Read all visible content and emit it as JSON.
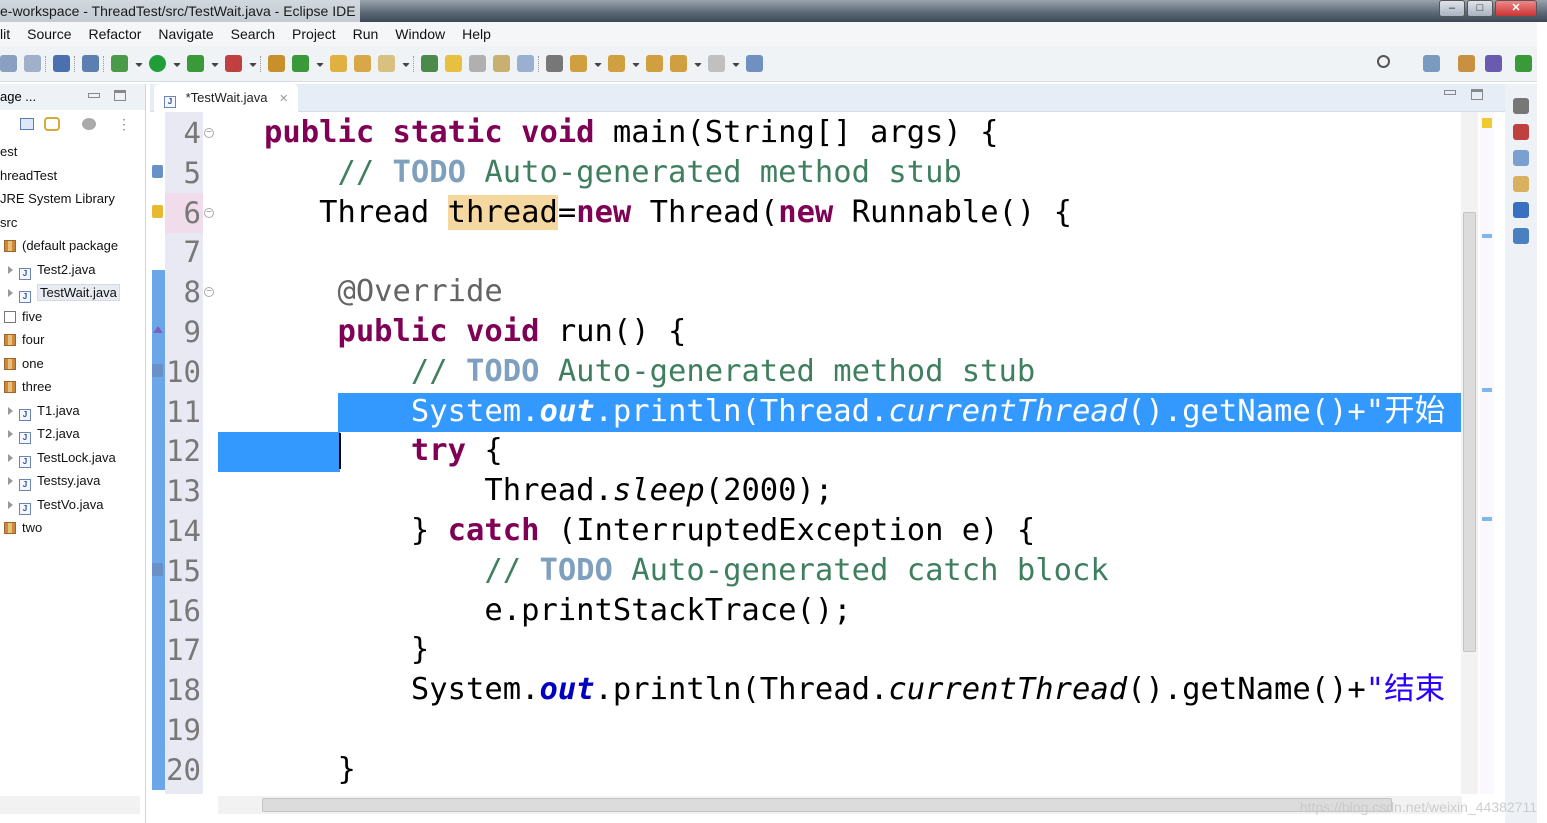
{
  "window": {
    "title": "e-workspace - ThreadTest/src/TestWait.java - Eclipse IDE",
    "min": "–",
    "max": "□",
    "close": "✕"
  },
  "menu": [
    "lit",
    "Source",
    "Refactor",
    "Navigate",
    "Search",
    "Project",
    "Run",
    "Window",
    "Help"
  ],
  "toolbar_icons": [
    "save-icon",
    "save-all-icon",
    "terminal-icon",
    "skip-breakpoints-icon",
    "debug-icon",
    "dropdown-icon",
    "run-icon",
    "dropdown-icon",
    "coverage-icon",
    "dropdown-icon",
    "external-tools-icon",
    "dropdown-icon",
    "new-java-package-icon",
    "new-class-icon",
    "dropdown-icon",
    "open-type-icon",
    "open-task-icon",
    "search-icon",
    "dropdown-icon",
    "toggle-mark-occurrences-icon",
    "toggle-highlight-icon",
    "show-whitespace-icon",
    "block-selection-icon",
    "word-wrap-icon",
    "pilcrow-icon",
    "next-annotation-icon",
    "dropdown-icon",
    "prev-annotation-icon",
    "dropdown-icon",
    "last-edit-icon",
    "back-icon",
    "dropdown-icon",
    "forward-icon",
    "dropdown-icon",
    "pin-editor-icon"
  ],
  "toolbar_right": [
    "search-icon",
    "open-perspective-icon",
    "git-perspective-icon",
    "java-perspective-icon",
    "debug-perspective-icon"
  ],
  "left_panel": {
    "title": "age ...",
    "tree": [
      {
        "label": "est",
        "level": 0,
        "icon": "none"
      },
      {
        "label": "hreadTest",
        "level": 0,
        "icon": "none"
      },
      {
        "label": "JRE System Library",
        "level": 0,
        "icon": "none"
      },
      {
        "label": "src",
        "level": 0,
        "icon": "none"
      },
      {
        "label": "(default package",
        "level": 1,
        "icon": "package"
      },
      {
        "label": "Test2.java",
        "level": 2,
        "icon": "java"
      },
      {
        "label": "TestWait.java",
        "level": 2,
        "icon": "java",
        "selected": true
      },
      {
        "label": "five",
        "level": 1,
        "icon": "empty-package"
      },
      {
        "label": "four",
        "level": 1,
        "icon": "package"
      },
      {
        "label": "one",
        "level": 1,
        "icon": "package"
      },
      {
        "label": "three",
        "level": 1,
        "icon": "package"
      },
      {
        "label": "T1.java",
        "level": 2,
        "icon": "java"
      },
      {
        "label": "T2.java",
        "level": 2,
        "icon": "java"
      },
      {
        "label": "TestLock.java",
        "level": 2,
        "icon": "java"
      },
      {
        "label": "Testsy.java",
        "level": 2,
        "icon": "java"
      },
      {
        "label": "TestVo.java",
        "level": 2,
        "icon": "java"
      },
      {
        "label": "two",
        "level": 1,
        "icon": "package"
      }
    ]
  },
  "editor": {
    "tab_label": "*TestWait.java",
    "tab_close": "✕",
    "current_line": 6,
    "selected_line": 11,
    "lines": [
      {
        "n": "4",
        "fold": true,
        "t": [
          [
            "public static void",
            "k"
          ],
          [
            " main(String[] args) {",
            ""
          ]
        ]
      },
      {
        "n": "5",
        "t": [
          [
            "    // ",
            "c"
          ],
          [
            "TODO",
            "todo"
          ],
          [
            " Auto-generated method stub",
            "c"
          ]
        ]
      },
      {
        "n": "6",
        "fold": true,
        "t": [
          [
            "   Thread ",
            ""
          ],
          [
            "thread",
            "occ"
          ],
          [
            "=",
            ""
          ],
          [
            "new",
            "k"
          ],
          [
            " Thread(",
            ""
          ],
          [
            "new",
            "k"
          ],
          [
            " Runnable() {",
            ""
          ]
        ]
      },
      {
        "n": "7",
        "t": []
      },
      {
        "n": "8",
        "fold": true,
        "t": [
          [
            "    @Override",
            "a"
          ]
        ]
      },
      {
        "n": "9",
        "t": [
          [
            "    public void",
            "k"
          ],
          [
            " run() {",
            ""
          ]
        ]
      },
      {
        "n": "10",
        "t": [
          [
            "        // ",
            "c"
          ],
          [
            "TODO",
            "todo"
          ],
          [
            " Auto-generated method stub",
            "c"
          ]
        ]
      },
      {
        "n": "11",
        "t": [
          [
            "        System.",
            ""
          ],
          [
            "out",
            "f"
          ],
          [
            ".println(Thread.",
            ""
          ],
          [
            "currentThread",
            "i"
          ],
          [
            "().getName()+",
            ""
          ],
          [
            "\"开始",
            "s"
          ]
        ]
      },
      {
        "n": "12",
        "t": [
          [
            "        try",
            "k"
          ],
          [
            " {",
            ""
          ]
        ]
      },
      {
        "n": "13",
        "t": [
          [
            "            Thread.",
            ""
          ],
          [
            "sleep",
            "i"
          ],
          [
            "(2000);",
            ""
          ]
        ]
      },
      {
        "n": "14",
        "t": [
          [
            "        } ",
            ""
          ],
          [
            "catch",
            "k"
          ],
          [
            " (InterruptedException e) {",
            ""
          ]
        ]
      },
      {
        "n": "15",
        "t": [
          [
            "            // ",
            "c"
          ],
          [
            "TODO",
            "todo"
          ],
          [
            " Auto-generated catch block",
            "c"
          ]
        ]
      },
      {
        "n": "16",
        "t": [
          [
            "            e.printStackTrace();",
            ""
          ]
        ]
      },
      {
        "n": "17",
        "t": [
          [
            "        }",
            ""
          ]
        ]
      },
      {
        "n": "18",
        "t": [
          [
            "        System.",
            ""
          ],
          [
            "out",
            "f"
          ],
          [
            ".println(Thread.",
            ""
          ],
          [
            "currentThread",
            "i"
          ],
          [
            "().getName()+",
            ""
          ],
          [
            "\"结束",
            "s"
          ]
        ]
      },
      {
        "n": "19",
        "t": []
      },
      {
        "n": "20",
        "t": [
          [
            "    }",
            ""
          ]
        ]
      }
    ]
  },
  "right_trim": [
    "restore-icon",
    "breakpoints-icon",
    "variables-icon",
    "expressions-icon",
    "console-icon",
    "debug-view-icon"
  ],
  "watermark": "https://blog.csdn.net/weixin_44382711",
  "colors": {
    "keyword": "#7f0055",
    "comment": "#3f7f5f",
    "field": "#0000c0",
    "string": "#2a00ff",
    "selection": "#3399ff"
  }
}
